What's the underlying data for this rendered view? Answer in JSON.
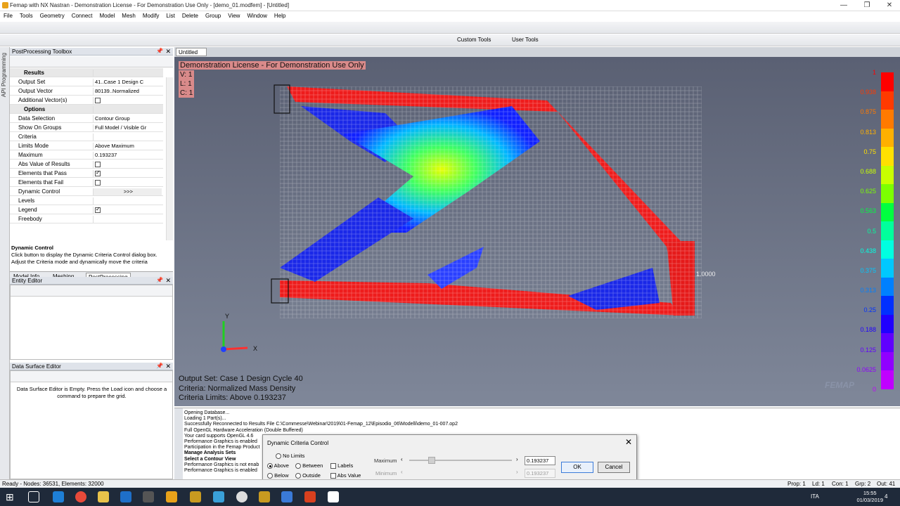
{
  "window": {
    "title": "Femap with NX Nastran - Demonstration License - For Demonstration Use Only - [demo_01.modfem] - [Untitled]",
    "controls": [
      "—",
      "❐",
      "✕"
    ]
  },
  "menu": [
    "File",
    "Tools",
    "Geometry",
    "Connect",
    "Model",
    "Mesh",
    "Modify",
    "List",
    "Delete",
    "Group",
    "View",
    "Window",
    "Help"
  ],
  "toolbar": {
    "custom_tools": "Custom Tools",
    "user_tools": "User Tools"
  },
  "left_strip_label": "API Programming",
  "postprocessing": {
    "header": "PostProcessing Toolbox",
    "rows": [
      {
        "k": "Results",
        "v": "",
        "section": true
      },
      {
        "k": "Output Set",
        "v": "41..Case 1 Design C"
      },
      {
        "k": "Output Vector",
        "v": "80139..Normalized"
      },
      {
        "k": "Additional Vector(s)",
        "v": "",
        "check": false
      },
      {
        "k": "Options",
        "v": "",
        "section": true
      },
      {
        "k": "Data Selection",
        "v": "Contour Group"
      },
      {
        "k": "Show On Groups",
        "v": "Full Model / Visible Gr"
      },
      {
        "k": "Criteria",
        "v": ""
      },
      {
        "k": "Limits Mode",
        "v": "Above Maximum"
      },
      {
        "k": "Maximum",
        "v": "0.193237"
      },
      {
        "k": "Abs Value of Results",
        "v": "",
        "check": false
      },
      {
        "k": "Elements that Pass",
        "v": "",
        "check": true
      },
      {
        "k": "Elements that Fail",
        "v": "",
        "check": false
      },
      {
        "k": "Dynamic Control",
        "v": ">>>"
      },
      {
        "k": "Levels",
        "v": ""
      },
      {
        "k": "Legend",
        "v": "",
        "check": true
      },
      {
        "k": "Freebody",
        "v": ""
      }
    ],
    "desc_title": "Dynamic Control",
    "desc_text": "Click button to display the Dynamic Criteria Control dialog box. Adjust the Criteria mode and dynamically move the criteria",
    "tabs": [
      "Model Info",
      "Meshing",
      "PostProcessing"
    ]
  },
  "entity_editor": {
    "header": "Entity Editor"
  },
  "data_surface_editor": {
    "header": "Data Surface Editor",
    "text": "Data Surface Editor is Empty. Press the Load icon and choose a command to prepare the grid."
  },
  "doc_tab": "Untitled",
  "viewport": {
    "license": "Demonstration License - For Demonstration Use Only",
    "vlc": [
      "V: 1",
      "L: 1",
      "C: 1"
    ],
    "output_set": "Output Set: Case 1 Design Cycle 40",
    "criteria": "Criteria: Normalized Mass Density",
    "limits": "Criteria Limits: Above 0.193237",
    "node_label": "1.0000",
    "axis_y": "Y",
    "axis_x": "X",
    "logo": "FEMAP",
    "legend_values": [
      "1",
      "0.938",
      "0.875",
      "0.813",
      "0.75",
      "0.688",
      "0.625",
      "0.563",
      "0.5",
      "0.438",
      "0.375",
      "0.313",
      "0.25",
      "0.188",
      "0.125",
      "0.0625",
      "0"
    ],
    "legend_colors": [
      "#ff0000",
      "#ff3a00",
      "#ff7a00",
      "#ffb000",
      "#ffe000",
      "#c8ff00",
      "#7cff00",
      "#00ff40",
      "#00ff9c",
      "#00ffe0",
      "#00c8ff",
      "#0080ff",
      "#0030ff",
      "#2000ff",
      "#6000ff",
      "#9000ff",
      "#c000ff"
    ]
  },
  "messages": [
    "Opening Database...",
    "Loading 1 Part(s)...",
    "Successfully Reconnected to Results File C:\\Commesse\\Webinar\\2019\\01-Femap_12\\Episodio_06\\Modelli\\demo_01-007.op2",
    "Full OpenGL Hardware Acceleration (Double Buffered)",
    "Your card supports OpenGL 4.6",
    "Performance Graphics is enabled",
    "Participation in the Femap Product",
    "Manage Analysis Sets",
    "Select a Contour View",
    "Performance Graphics is not enab",
    "Performance Graphics is enabled"
  ],
  "dialog": {
    "title": "Dynamic Criteria Control",
    "no_limits": "No Limits",
    "above": "Above",
    "between": "Between",
    "below": "Below",
    "outside": "Outside",
    "labels": "Labels",
    "abs_value": "Abs Value",
    "maximum_label": "Maximum",
    "minimum_label": "Minimum",
    "maximum_value": "0.193237",
    "minimum_value": "0.193237",
    "ok": "OK",
    "cancel": "Cancel",
    "mode_selected": "Above"
  },
  "status": {
    "left": "Ready - Nodes: 36531, Elements: 32000",
    "prop": "Prop: 1",
    "ld": "Ld: 1",
    "con": "Con: 1",
    "grp": "Grp: 2",
    "out": "Out: 41"
  },
  "taskbar": {
    "lang": "ITA",
    "time": "15:55",
    "date": "01/03/2019",
    "notif": "4"
  }
}
